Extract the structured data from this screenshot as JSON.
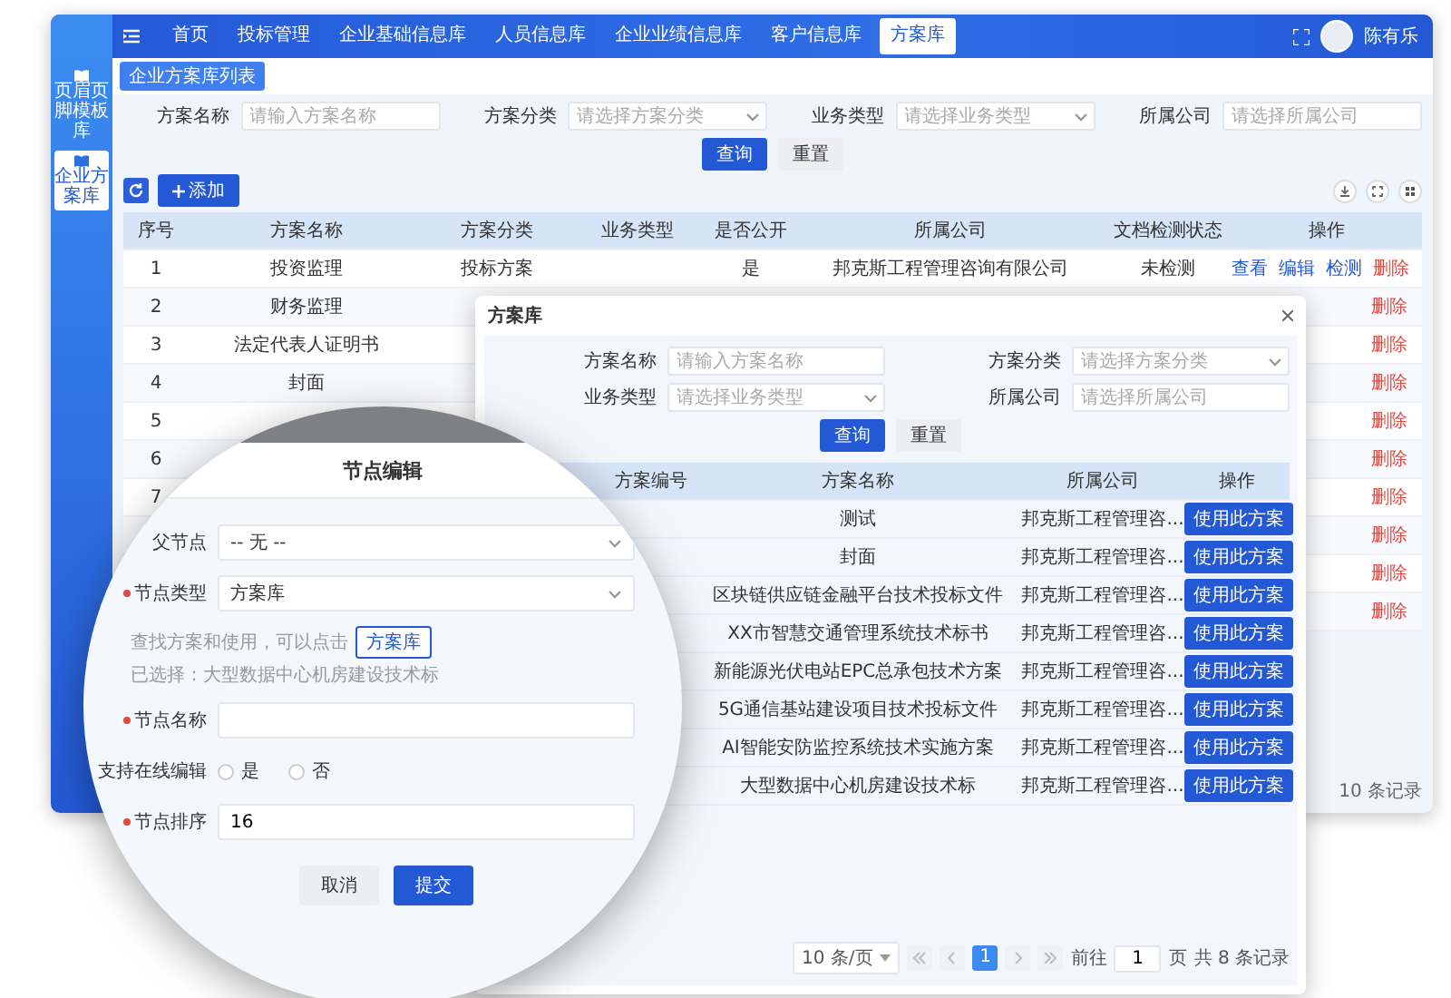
{
  "header": {
    "nav": [
      {
        "label": "首页",
        "selected": false
      },
      {
        "label": "投标管理",
        "selected": false
      },
      {
        "label": "企业基础信息库",
        "selected": false
      },
      {
        "label": "人员信息库",
        "selected": false
      },
      {
        "label": "企业业绩信息库",
        "selected": false
      },
      {
        "label": "客户信息库",
        "selected": false
      },
      {
        "label": "方案库",
        "selected": true
      }
    ],
    "user": "陈有乐"
  },
  "sidebar": {
    "items": [
      {
        "label": "页眉页脚模板库",
        "selected": false
      },
      {
        "label": "企业方案库",
        "selected": true
      }
    ]
  },
  "page_tab": "企业方案库列表",
  "filters": [
    {
      "kind": "input",
      "label": "方案名称",
      "placeholder": "请输入方案名称"
    },
    {
      "kind": "select",
      "label": "方案分类",
      "placeholder": "请选择方案分类"
    },
    {
      "kind": "select",
      "label": "业务类型",
      "placeholder": "请选择业务类型"
    },
    {
      "kind": "input",
      "label": "所属公司",
      "placeholder": "请选择所属公司"
    }
  ],
  "filter_buttons": [
    {
      "label": "查询",
      "kind": "primary"
    },
    {
      "label": "重置",
      "kind": "default"
    }
  ],
  "add_button": "添加",
  "table": {
    "columns": [
      "序号",
      "方案名称",
      "方案分类",
      "业务类型",
      "是否公开",
      "所属公司",
      "文档检测状态",
      "操作"
    ],
    "rows": [
      {
        "no": "1",
        "name": "投资监理",
        "category": "投标方案",
        "public": "是",
        "company": "邦克斯工程管理咨询有限公司",
        "check_status": "未检测",
        "actions": [
          {
            "label": "查看",
            "kind": "link"
          },
          {
            "label": "编辑",
            "kind": "link"
          },
          {
            "label": "检测",
            "kind": "link"
          },
          {
            "label": "删除",
            "kind": "danger"
          }
        ]
      },
      {
        "no": "2",
        "name": "财务监理",
        "actions": [
          {
            "label": "删除",
            "kind": "danger"
          }
        ]
      },
      {
        "no": "3",
        "name": "法定代表人证明书",
        "actions": [
          {
            "label": "删除",
            "kind": "danger"
          }
        ]
      },
      {
        "no": "4",
        "name": "封面",
        "actions": [
          {
            "label": "删除",
            "kind": "danger"
          }
        ]
      },
      {
        "no": "5",
        "actions": [
          {
            "label": "删除",
            "kind": "danger"
          }
        ]
      },
      {
        "no": "6",
        "actions": [
          {
            "label": "删除",
            "kind": "danger"
          }
        ]
      },
      {
        "no": "7",
        "actions": [
          {
            "label": "删除",
            "kind": "danger"
          }
        ]
      },
      {
        "actions": [
          {
            "label": "删除",
            "kind": "danger"
          }
        ]
      },
      {
        "actions": [
          {
            "label": "删除",
            "kind": "danger"
          }
        ]
      },
      {
        "actions": [
          {
            "label": "删除",
            "kind": "danger"
          }
        ]
      }
    ],
    "footer": "10 条记录"
  },
  "modal": {
    "title": "方案库",
    "filters": [
      {
        "kind": "input",
        "label": "方案名称",
        "placeholder": "请输入方案名称"
      },
      {
        "kind": "select",
        "label": "方案分类",
        "placeholder": "请选择方案分类"
      },
      {
        "kind": "select",
        "label": "业务类型",
        "placeholder": "请选择业务类型"
      },
      {
        "kind": "input",
        "label": "所属公司",
        "placeholder": "请选择所属公司"
      }
    ],
    "buttons": [
      {
        "label": "查询",
        "kind": "primary"
      },
      {
        "label": "重置",
        "kind": "default"
      }
    ],
    "columns": [
      "方案编号",
      "方案名称",
      "所属公司",
      "操作"
    ],
    "rows": [
      {
        "name": "测试",
        "company": "邦克斯工程管理咨...",
        "action": "使用此方案"
      },
      {
        "name": "封面",
        "company": "邦克斯工程管理咨...",
        "action": "使用此方案"
      },
      {
        "name": "区块链供应链金融平台技术投标文件",
        "company": "邦克斯工程管理咨...",
        "action": "使用此方案"
      },
      {
        "name": "XX市智慧交通管理系统技术标书",
        "company": "邦克斯工程管理咨...",
        "action": "使用此方案"
      },
      {
        "name": "新能源光伏电站EPC总承包技术方案",
        "company": "邦克斯工程管理咨...",
        "action": "使用此方案"
      },
      {
        "name": "5G通信基站建设项目技术投标文件",
        "company": "邦克斯工程管理咨...",
        "action": "使用此方案"
      },
      {
        "name": "AI智能安防监控系统技术实施方案",
        "company": "邦克斯工程管理咨...",
        "action": "使用此方案"
      },
      {
        "name": "大型数据中心机房建设技术标",
        "company": "邦克斯工程管理咨...",
        "action": "使用此方案"
      }
    ],
    "pagination": {
      "page_size": "10 条/页",
      "pages": [
        {
          "label": "1",
          "selected": true
        }
      ],
      "goto_label": "前往",
      "goto_value": "1",
      "page_unit": "页",
      "total": "共 8 条记录"
    }
  },
  "node_editor": {
    "title": "节点编辑",
    "fields": [
      {
        "kind": "select",
        "label": "父节点",
        "required": false,
        "value": "-- 无 --"
      },
      {
        "kind": "select",
        "label": "节点类型",
        "required": true,
        "value": "方案库"
      },
      {
        "kind": "hint",
        "text": "查找方案和使用，可以点击",
        "button": "方案库",
        "selected_text": "已选择：大型数据中心机房建设技术标"
      },
      {
        "kind": "input",
        "label": "节点名称",
        "required": true
      },
      {
        "kind": "radio",
        "label": "支持在线编辑",
        "required": false,
        "options": [
          {
            "label": "是",
            "selected": false
          },
          {
            "label": "否",
            "selected": false
          }
        ]
      },
      {
        "kind": "input",
        "label": "节点排序",
        "required": true,
        "value": "16"
      }
    ],
    "buttons": [
      {
        "label": "取消",
        "kind": "default"
      },
      {
        "label": "提交",
        "kind": "primary"
      }
    ]
  }
}
